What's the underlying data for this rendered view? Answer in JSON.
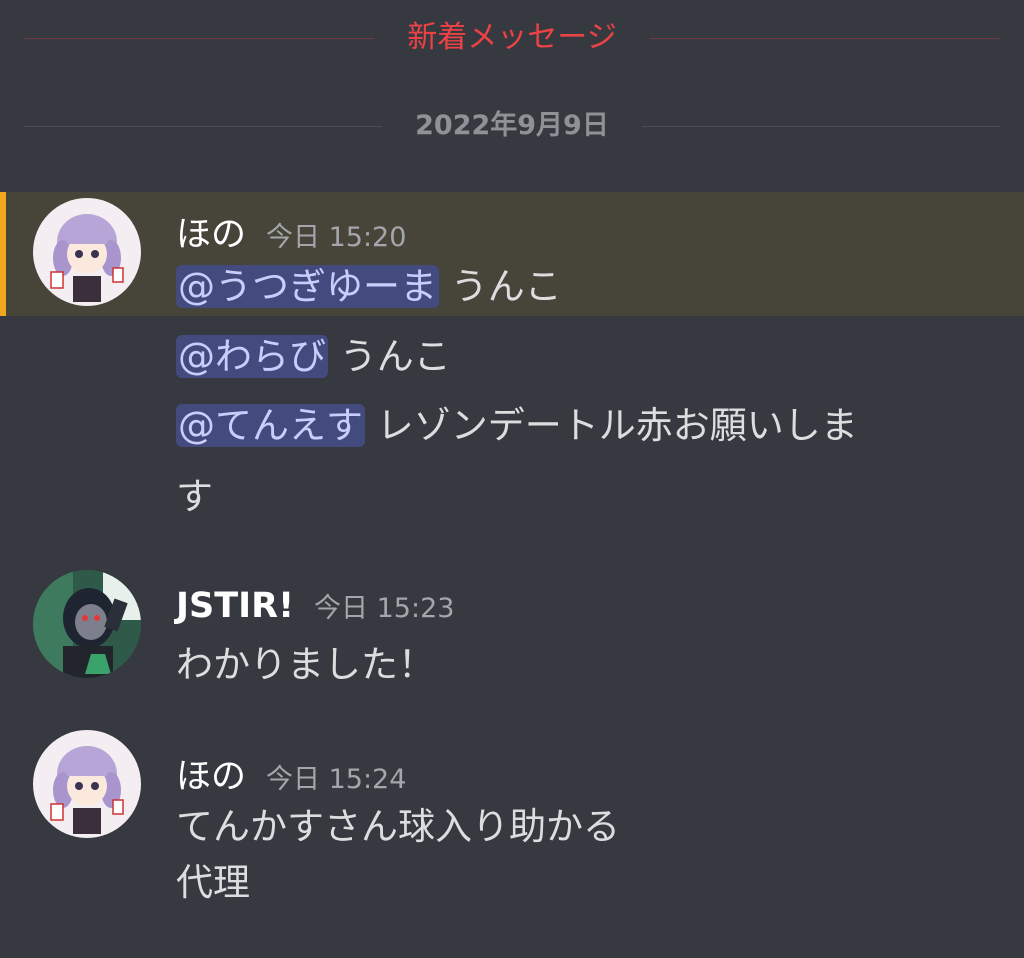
{
  "dividers": {
    "new_messages": "新着メッセージ",
    "date": "2022年9月9日"
  },
  "colors": {
    "background": "#36393f",
    "highlight": "#47443a",
    "highlight_bar": "#f0a81f",
    "new_messages": "#ed4245",
    "mention_bg": "#434b7e",
    "mention_text": "#c9cdfb"
  },
  "messages": [
    {
      "username": "ほの",
      "timestamp": "今日 15:20",
      "lines": [
        {
          "mention": "@うつぎゆーま",
          "text": " うんこ"
        },
        {
          "mention": "@わらび",
          "text": " うんこ"
        },
        {
          "mention": "@てんえす",
          "text": " レゾンデートル赤お願いしま"
        },
        {
          "mention": "",
          "text": "す"
        }
      ]
    },
    {
      "username": "JSTIR!",
      "timestamp": "今日 15:23",
      "lines": [
        {
          "mention": "",
          "text": "わかりました！"
        }
      ]
    },
    {
      "username": "ほの",
      "timestamp": "今日 15:24",
      "lines": [
        {
          "mention": "",
          "text": "てんかすさん球入り助かる"
        },
        {
          "mention": "",
          "text": "代理"
        }
      ]
    }
  ]
}
